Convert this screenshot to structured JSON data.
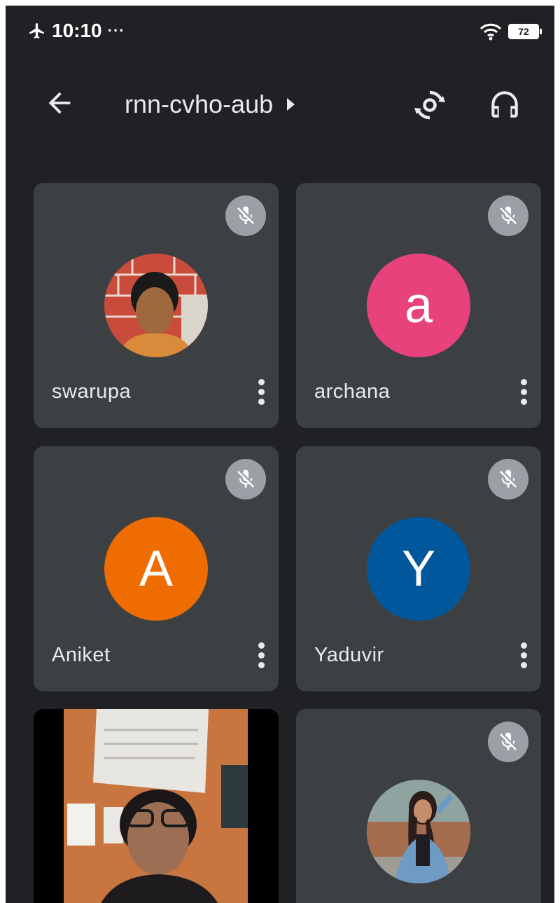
{
  "status_bar": {
    "time": "10:10",
    "dots": "···",
    "battery": "72",
    "icons": [
      "airplane-icon",
      "wifi-icon",
      "battery-icon"
    ]
  },
  "header": {
    "meeting_code": "rnn-cvho-aub",
    "icons": [
      "back-arrow-icon",
      "switch-camera-icon",
      "headphones-icon"
    ]
  },
  "participants": [
    {
      "name": "swarupa",
      "avatar_type": "photo",
      "muted": true
    },
    {
      "name": "archana",
      "avatar_type": "letter",
      "letter": "a",
      "color": "#E8427C",
      "muted": true
    },
    {
      "name": "Aniket",
      "avatar_type": "letter",
      "letter": "A",
      "color": "#EF6C00",
      "muted": true
    },
    {
      "name": "Yaduvir",
      "avatar_type": "letter",
      "letter": "Y",
      "color": "#01579B",
      "muted": true
    },
    {
      "avatar_type": "video",
      "muted": false
    },
    {
      "avatar_type": "photo",
      "muted": true
    }
  ],
  "colors": {
    "background": "#202124",
    "tile": "#3c4043",
    "mute_badge": "#9aa0a6",
    "text": "#e8eaed"
  }
}
